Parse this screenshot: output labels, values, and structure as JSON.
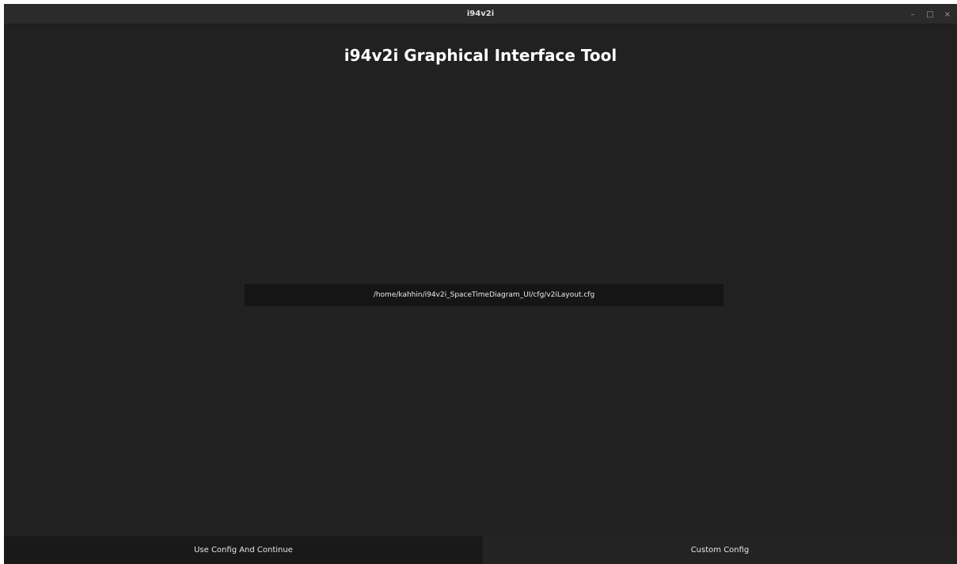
{
  "window": {
    "title": "i94v2i",
    "controls": {
      "minimize": "–",
      "maximize": "□",
      "close": "×"
    }
  },
  "main": {
    "heading": "i94v2i Graphical Interface Tool",
    "config_path": "/home/kahhin/i94v2i_SpaceTimeDiagram_UI/cfg/v2iLayout.cfg"
  },
  "footer": {
    "use_config_label": "Use Config And Continue",
    "custom_config_label": "Custom Config"
  },
  "colors": {
    "background": "#212121",
    "titlebar": "#2b2b2b",
    "path_field": "#151515",
    "text": "#ffffff"
  }
}
